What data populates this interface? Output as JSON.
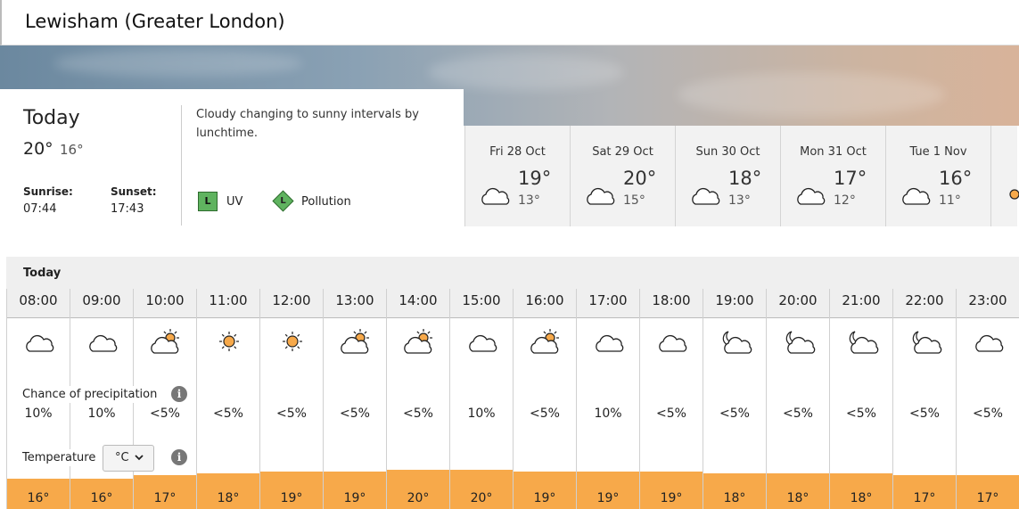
{
  "location": "Lewisham (Greater London)",
  "today": {
    "label": "Today",
    "high": "20°",
    "low": "16°",
    "sunrise_label": "Sunrise:",
    "sunrise": "07:44",
    "sunset_label": "Sunset:",
    "sunset": "17:43",
    "description": "Cloudy changing to sunny intervals by lunchtime.",
    "uv_level": "L",
    "uv_label": "UV",
    "pollution_level": "L",
    "pollution_label": "Pollution"
  },
  "days": [
    {
      "name": "Fri 28 Oct",
      "high": "19°",
      "low": "13°",
      "icon": "cloud-icon"
    },
    {
      "name": "Sat 29 Oct",
      "high": "20°",
      "low": "15°",
      "icon": "cloud-icon"
    },
    {
      "name": "Sun 30 Oct",
      "high": "18°",
      "low": "13°",
      "icon": "cloud-icon"
    },
    {
      "name": "Mon 31 Oct",
      "high": "17°",
      "low": "12°",
      "icon": "cloud-icon"
    },
    {
      "name": "Tue 1 Nov",
      "high": "16°",
      "low": "11°",
      "icon": "cloud-icon"
    }
  ],
  "hourly": {
    "day_label": "Today",
    "precip_label": "Chance of precipitation",
    "temp_label": "Temperature",
    "unit": "°C",
    "hours": [
      {
        "time": "08:00",
        "icon": "cloud",
        "precip": "10%",
        "temp": "16°",
        "level": 0.42
      },
      {
        "time": "09:00",
        "icon": "cloud",
        "precip": "10%",
        "temp": "16°",
        "level": 0.42
      },
      {
        "time": "10:00",
        "icon": "sun-cloud",
        "precip": "<5%",
        "temp": "17°",
        "level": 0.48
      },
      {
        "time": "11:00",
        "icon": "sun",
        "precip": "<5%",
        "temp": "18°",
        "level": 0.5
      },
      {
        "time": "12:00",
        "icon": "sun",
        "precip": "<5%",
        "temp": "19°",
        "level": 0.53
      },
      {
        "time": "13:00",
        "icon": "sun-cloud",
        "precip": "<5%",
        "temp": "19°",
        "level": 0.53
      },
      {
        "time": "14:00",
        "icon": "sun-cloud",
        "precip": "<5%",
        "temp": "20°",
        "level": 0.55
      },
      {
        "time": "15:00",
        "icon": "cloud",
        "precip": "10%",
        "temp": "20°",
        "level": 0.55
      },
      {
        "time": "16:00",
        "icon": "sun-cloud",
        "precip": "<5%",
        "temp": "19°",
        "level": 0.53
      },
      {
        "time": "17:00",
        "icon": "cloud",
        "precip": "10%",
        "temp": "19°",
        "level": 0.53
      },
      {
        "time": "18:00",
        "icon": "cloud",
        "precip": "<5%",
        "temp": "19°",
        "level": 0.53
      },
      {
        "time": "19:00",
        "icon": "moon-cloud",
        "precip": "<5%",
        "temp": "18°",
        "level": 0.5
      },
      {
        "time": "20:00",
        "icon": "moon-cloud",
        "precip": "<5%",
        "temp": "18°",
        "level": 0.5
      },
      {
        "time": "21:00",
        "icon": "moon-cloud",
        "precip": "<5%",
        "temp": "18°",
        "level": 0.5
      },
      {
        "time": "22:00",
        "icon": "moon-cloud",
        "precip": "<5%",
        "temp": "17°",
        "level": 0.48
      },
      {
        "time": "23:00",
        "icon": "cloud",
        "precip": "<5%",
        "temp": "17°",
        "level": 0.48
      }
    ]
  }
}
